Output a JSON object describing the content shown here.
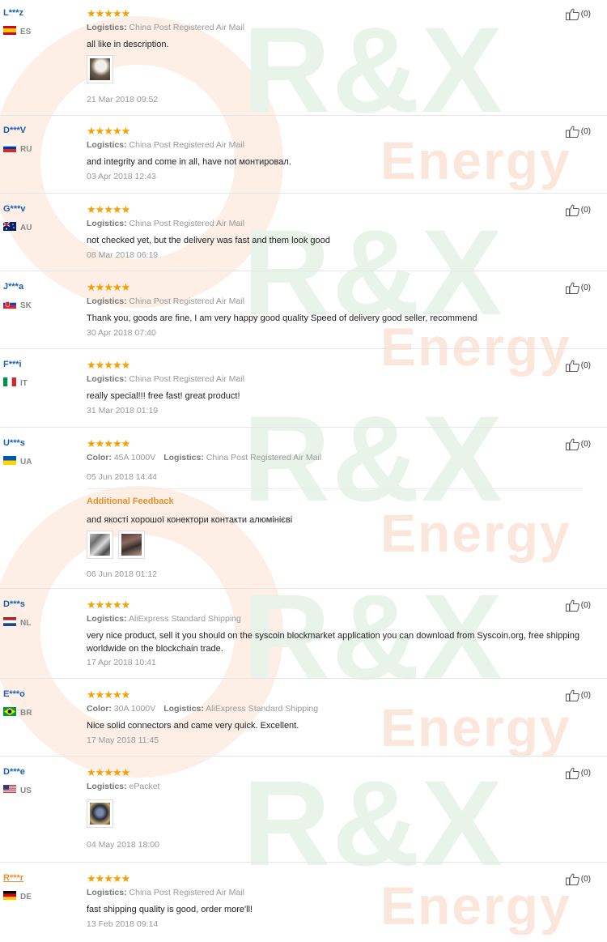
{
  "watermark": {
    "brand": "R&X",
    "word": "Energy"
  },
  "icons": {
    "star": "star-icon",
    "like": "thumbs-up-icon"
  },
  "colors": {
    "star": "#f5a000",
    "buyer_link": "#1b5fb3",
    "accent_orange": "#e8902b"
  },
  "reviews": [
    {
      "buyer": "L***z",
      "country": "ES",
      "rating": 5,
      "logistics_label": "Logistics:",
      "logistics": "China Post Registered Air Mail",
      "text": "all like in description.",
      "photos": 1,
      "date": "21 Mar 2018 09:52",
      "helpful": "(0)"
    },
    {
      "buyer": "D***V",
      "country": "RU",
      "rating": 5,
      "logistics_label": "Logistics:",
      "logistics": "China Post Registered Air Mail",
      "text": "and integrity and come in all, have not монтировал.",
      "date": "03 Apr 2018 12:43",
      "helpful": "(0)"
    },
    {
      "buyer": "G***v",
      "country": "AU",
      "rating": 5,
      "logistics_label": "Logistics:",
      "logistics": "China Post Registered Air Mail",
      "text": "not checked yet, but the delivery was fast and them look good",
      "date": "08 Mar 2018 06:19",
      "helpful": "(0)"
    },
    {
      "buyer": "J***a",
      "country": "SK",
      "rating": 5,
      "logistics_label": "Logistics:",
      "logistics": "China Post Registered Air Mail",
      "text": "Thank you, goods are fine, I am very happy good quality Speed of delivery good seller, recommend",
      "date": "30 Apr 2018 07:40",
      "helpful": "(0)"
    },
    {
      "buyer": "F***i",
      "country": "IT",
      "rating": 5,
      "logistics_label": "Logistics:",
      "logistics": "China Post Registered Air Mail",
      "text": "really special!!! free fast! great product!",
      "date": "31 Mar 2018 01:19",
      "helpful": "(0)"
    },
    {
      "buyer": "U***s",
      "country": "UA",
      "rating": 5,
      "color_label": "Color:",
      "color": "45A 1000V",
      "logistics_label": "Logistics:",
      "logistics": "China Post Registered Air Mail",
      "date": "05 Jun 2018 14:44",
      "additional_title": "Additional Feedback",
      "additional_text": "and якості хорошої конектори контакти алюмінієві",
      "additional_photos": 2,
      "additional_date": "06 Jun 2018 01:12",
      "helpful": "(0)"
    },
    {
      "buyer": "D***s",
      "country": "NL",
      "rating": 5,
      "logistics_label": "Logistics:",
      "logistics": "AliExpress Standard Shipping",
      "text": "very nice product, sell it you should on the syscoin blockmarket application you can download from Syscoin.org, free shipping worldwide on the blockchain trade.",
      "date": "17 Apr 2018 10:41",
      "helpful": "(0)"
    },
    {
      "buyer": "E***o",
      "country": "BR",
      "rating": 5,
      "color_label": "Color:",
      "color": "30A 1000V",
      "logistics_label": "Logistics:",
      "logistics": "AliExpress Standard Shipping",
      "text": "Nice solid connectors and came very quick. Excellent.",
      "date": "17 May 2018 11:45",
      "helpful": "(0)"
    },
    {
      "buyer": "D***e",
      "country": "US",
      "rating": 5,
      "logistics_label": "Logistics:",
      "logistics": "ePacket",
      "photos": 1,
      "date": "04 May 2018 18:00",
      "helpful": "(0)"
    },
    {
      "buyer": "R***r",
      "country": "DE",
      "rating": 5,
      "logistics_label": "Logistics:",
      "logistics": "China Post Registered Air Mail",
      "text": "fast shipping quality is good, order more'll!",
      "date": "13 Feb 2018 09:14",
      "helpful": "(0)"
    }
  ]
}
